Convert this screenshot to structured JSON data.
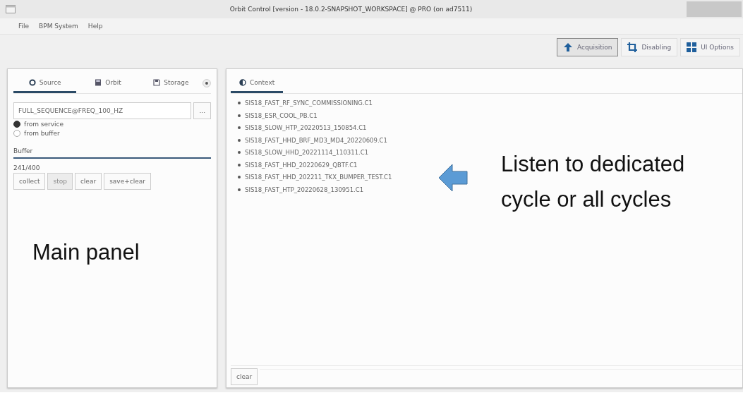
{
  "window": {
    "title": "Orbit Control [version - 18.0.2-SNAPSHOT_WORKSPACE] @ PRO (on ad7511)"
  },
  "menu": [
    "File",
    "BPM System",
    "Help"
  ],
  "toolbar": [
    {
      "label": "Acquisition",
      "kind": "arrow",
      "selected": true
    },
    {
      "label": "Disabling",
      "kind": "crop",
      "selected": false
    },
    {
      "label": "UI Options",
      "kind": "grid",
      "selected": false
    }
  ],
  "left_panel": {
    "tabs": [
      {
        "label": "Source",
        "kind": "source",
        "selected": true
      },
      {
        "label": "Orbit",
        "kind": "orbit",
        "selected": false
      },
      {
        "label": "Storage",
        "kind": "storage",
        "selected": false
      }
    ],
    "sequence_field": {
      "value": "FULL_SEQUENCE@FREQ_100_HZ",
      "button": "..."
    },
    "radios": [
      {
        "label": "from service",
        "selected": true
      },
      {
        "label": "from buffer",
        "selected": false
      }
    ],
    "buffer": {
      "title": "Buffer",
      "counter": "241/400",
      "buttons": [
        {
          "label": "collect",
          "disabled": false
        },
        {
          "label": "stop",
          "disabled": true
        },
        {
          "label": "clear",
          "disabled": false
        },
        {
          "label": "save+clear",
          "disabled": false
        }
      ]
    }
  },
  "right_panel": {
    "tabs": [
      {
        "label": "Context",
        "selected": true
      }
    ],
    "cycles": [
      "SIS18_FAST_RF_SYNC_COMMISSIONING.C1",
      "SIS18_ESR_COOL_PB.C1",
      "SIS18_SLOW_HTP_20220513_150854.C1",
      "SIS18_FAST_HHD_BRF_MD3_MD4_20220609.C1",
      "SIS18_SLOW_HHD_20221114_110311.C1",
      "SIS18_FAST_HHD_20220629_QBTF.C1",
      "SIS18_FAST_HHD_202211_TKX_BUMPER_TEST.C1",
      "SIS18_FAST_HTP_20220628_130951.C1"
    ],
    "clear_button": "clear"
  },
  "annotations": [
    {
      "kind": "label",
      "text": "Main panel"
    },
    {
      "kind": "callout",
      "text": "Listen to dedicated cycle or all cycles"
    }
  ]
}
